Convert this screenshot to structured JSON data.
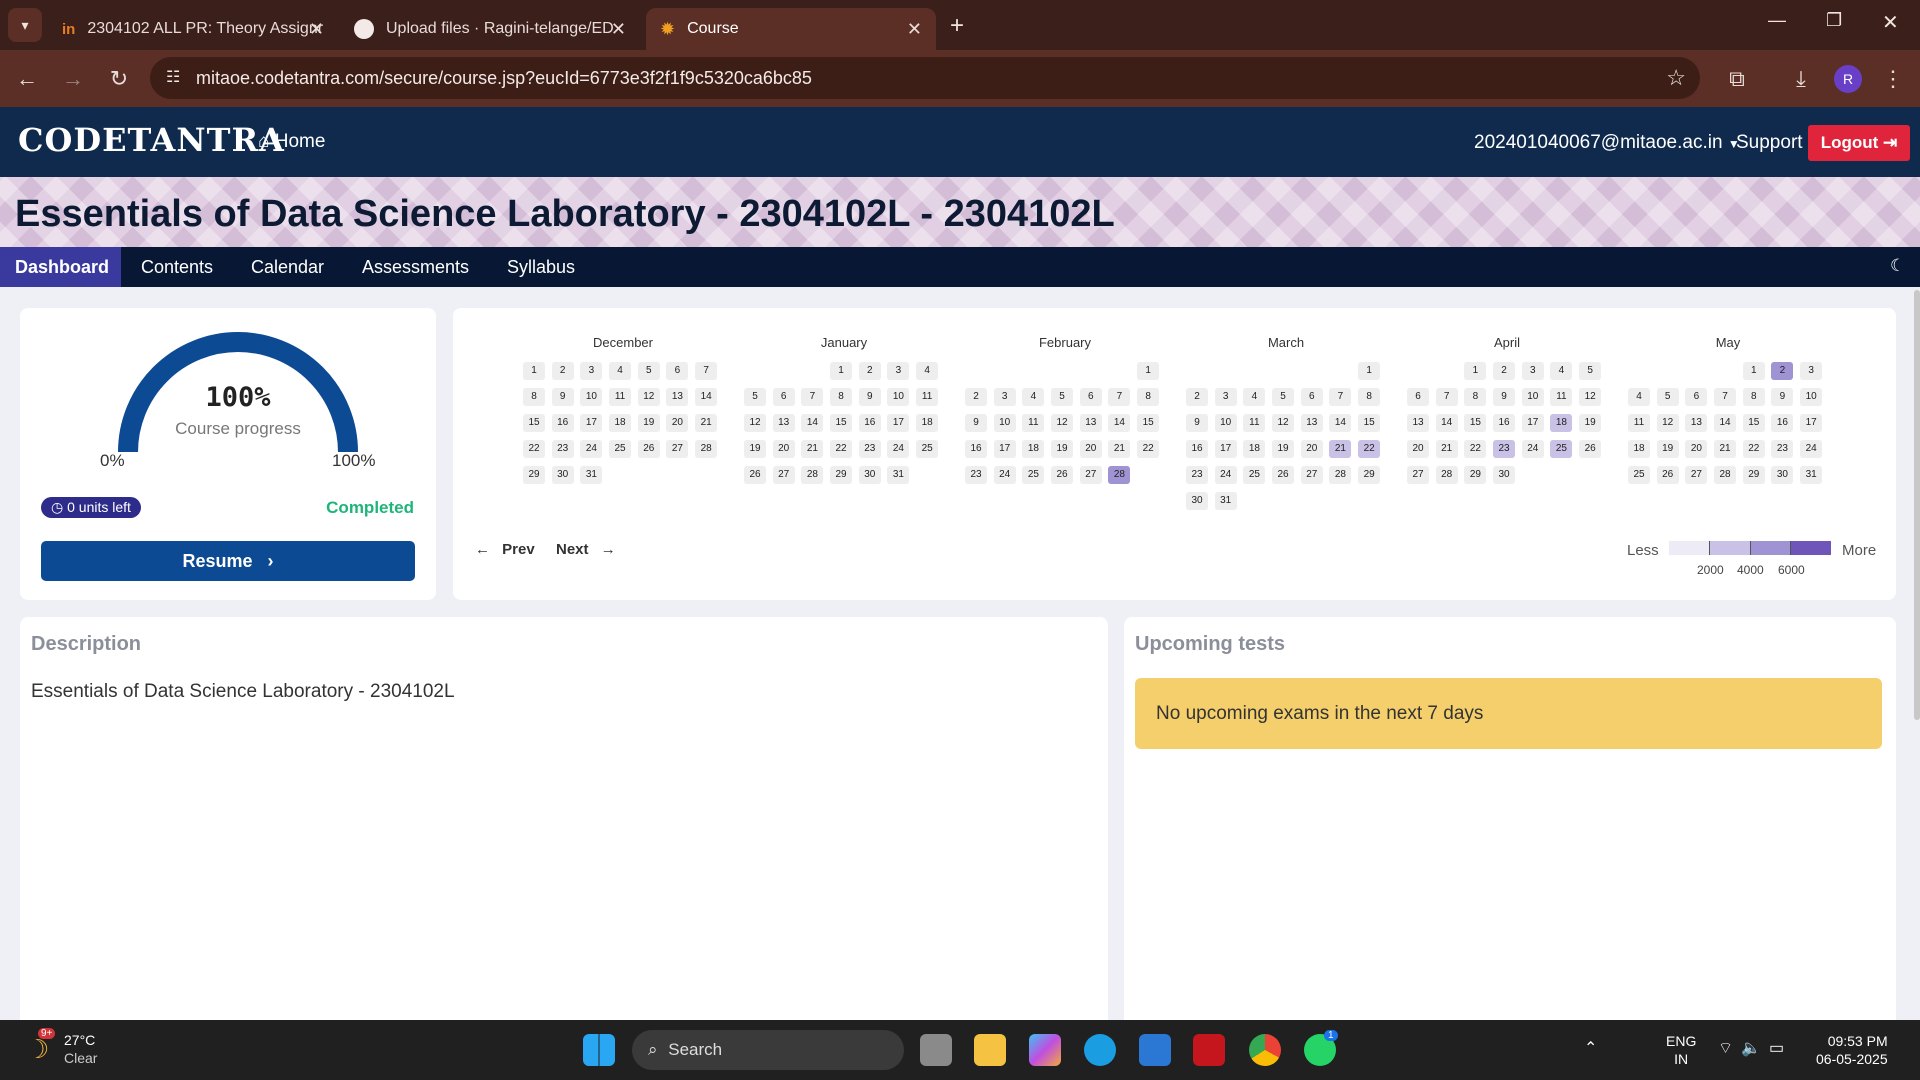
{
  "browser": {
    "tabs": [
      {
        "title": "2304102 ALL PR: Theory Assignment",
        "icon": "nptel-icon"
      },
      {
        "title": "Upload files · Ragini-telange/ED",
        "icon": "github-icon"
      },
      {
        "title": "Course",
        "icon": "codetantra-icon",
        "active": true
      }
    ],
    "url": "mitaoe.codetantra.com/secure/course.jsp?eucId=6773e3f2f1f9c5320ca6bc85",
    "profile_initial": "R"
  },
  "site": {
    "logo": "CODETANTRA",
    "home": "Home",
    "user": "202401040067@mitaoe.ac.in",
    "support": "Support",
    "logout": "Logout"
  },
  "course": {
    "title": "Essentials of Data Science Laboratory - 2304102L - 2304102L",
    "nav": [
      "Dashboard",
      "Contents",
      "Calendar",
      "Assessments",
      "Syllabus"
    ]
  },
  "progress": {
    "value": 1.0,
    "percent_text": "100%",
    "label": "Course progress",
    "min_label": "0%",
    "max_label": "100%",
    "units_left": "0 units left",
    "status": "Completed",
    "resume": "Resume",
    "color": "#0d4a94"
  },
  "calendar": {
    "months": [
      {
        "name": "December",
        "offset": 0,
        "days": 31,
        "lvl1": [],
        "lvl2": []
      },
      {
        "name": "January",
        "offset": 3,
        "days": 31,
        "lvl1": [],
        "lvl2": []
      },
      {
        "name": "February",
        "offset": 6,
        "days": 28,
        "lvl1": [],
        "lvl2": [
          28
        ]
      },
      {
        "name": "March",
        "offset": 6,
        "days": 31,
        "lvl1": [
          21,
          22
        ],
        "lvl2": []
      },
      {
        "name": "April",
        "offset": 2,
        "days": 30,
        "lvl1": [
          18,
          23,
          25
        ],
        "lvl2": []
      },
      {
        "name": "May",
        "offset": 4,
        "days": 31,
        "lvl1": [],
        "lvl2": [
          2
        ]
      }
    ],
    "prev": "Prev",
    "next": "Next",
    "legend": {
      "less": "Less",
      "more": "More",
      "ticks": [
        "2000",
        "4000",
        "6000"
      ]
    }
  },
  "description": {
    "heading": "Description",
    "text": "Essentials of Data Science Laboratory - 2304102L"
  },
  "tests": {
    "heading": "Upcoming tests",
    "message": "No upcoming exams in the next 7 days"
  },
  "taskbar": {
    "temp": "27°C",
    "weather": "Clear",
    "weather_badge": "9+",
    "search": "Search",
    "lang1": "ENG",
    "lang2": "IN",
    "time": "09:53 PM",
    "date": "06-05-2025",
    "whatsapp_badge": "1"
  }
}
